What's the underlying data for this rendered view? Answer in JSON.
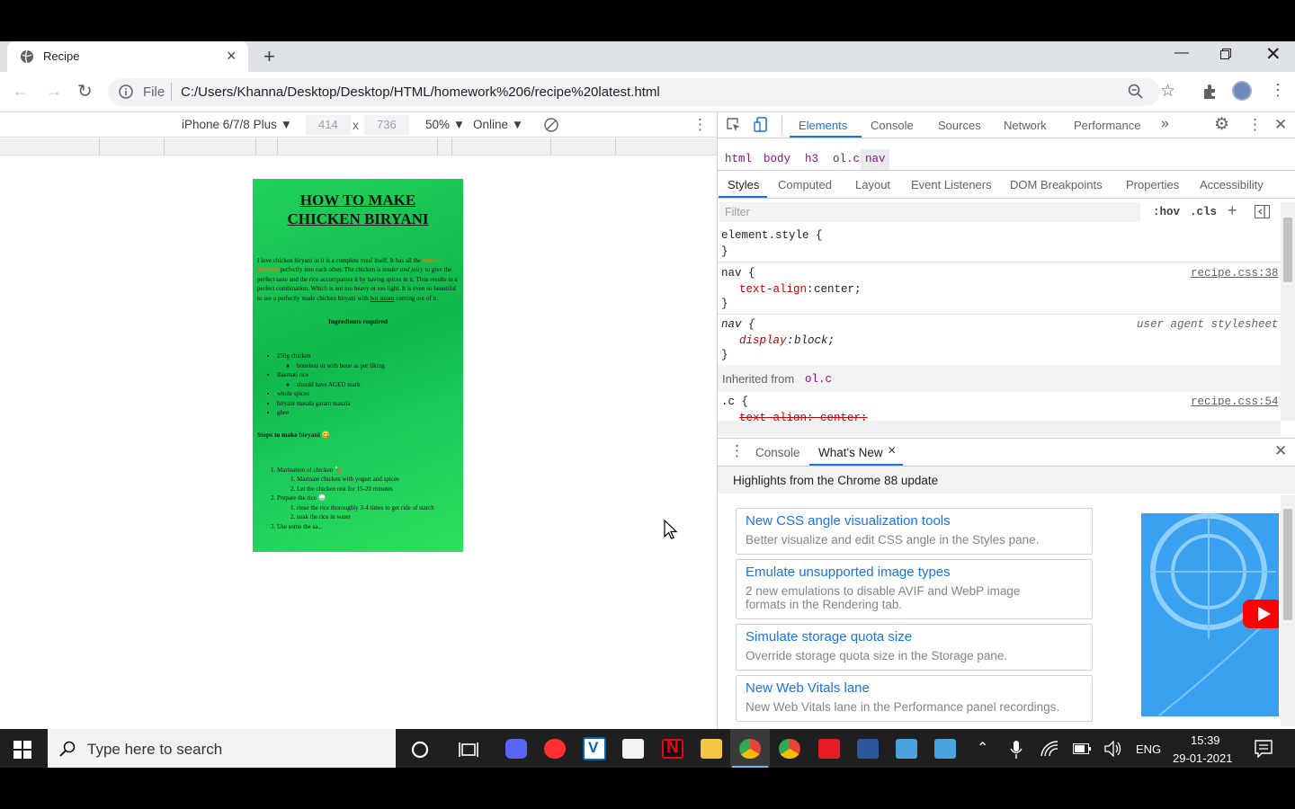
{
  "browser": {
    "tab_title": "Recipe",
    "address_prefix": "File",
    "url": "C:/Users/Khanna/Desktop/Desktop/HTML/homework%206/recipe%20latest.html"
  },
  "device_toolbar": {
    "device": "iPhone 6/7/8 Plus ▼",
    "width": "414",
    "x": "x",
    "height": "736",
    "zoom": "50% ▼",
    "network": "Online ▼"
  },
  "recipe_page": {
    "title_line1": "HOW TO MAKE",
    "title_line2": "CHICKEN BIRYANI",
    "intro_a": "I love chicken biryani as it is a complete meal itself. It has all the ",
    "intro_orange": "flavour blended",
    "intro_b": " perfectly into each other. The chicken is ",
    "intro_em": "tender and juicy",
    "intro_c": " to give the perfect taste and the rice accompanies it by having spices in it. Thus results in a perfect combination. Which is not too heavy or too light. It is even so beautiful to see a perfectly made chicken biryani with ",
    "intro_link": "hot steam",
    "intro_d": " coming out of it.",
    "ingredients_heading": "Ingredients required",
    "ing1": "250g chicken",
    "ing1_sub": "boneless or with bone as per liking",
    "ing2": "Basmati rice",
    "ing2_sub": "should have AGED mark",
    "ing3": "whole spices",
    "ing4": "biryani masala garam masala",
    "ing5": "ghee",
    "steps_heading": "Steps to make biryani 😋",
    "step1": "Marination of chicken 🍗",
    "step1_a": "Marinate chicken with yogurt and spices",
    "step1_b": "Let the chicken rest for 15-20 minutes",
    "step2": "Prepare the rice 🍚",
    "step2_a": "rinse the rice thoroughly 3-4 times to get ride of starch",
    "step2_b": "soak the rice in water",
    "step3": "Use some the sa..."
  },
  "devtools": {
    "tabs": [
      "Elements",
      "Console",
      "Sources",
      "Network",
      "Performance"
    ],
    "more": "»",
    "breadcrumb": [
      "html",
      "body",
      "h3",
      "ol.c",
      "nav"
    ],
    "subtabs": [
      "Styles",
      "Computed",
      "Layout",
      "Event Listeners",
      "DOM Breakpoints",
      "Properties",
      "Accessibility"
    ],
    "filter_placeholder": "Filter",
    "hov": ":hov",
    "cls": ".cls",
    "rule0_selector": "element.style {",
    "close_brace": "}",
    "rule1_selector": "nav {",
    "rule1_prop": "text-align",
    "rule1_val": " center;",
    "rule1_src": "recipe.css:38",
    "rule2_selector": "nav {",
    "rule2_prop": "display",
    "rule2_val": " block;",
    "rule2_src": "user agent stylesheet",
    "inherited_label": "Inherited from ",
    "inherited_from": "ol.c",
    "rule3_selector": ".c {",
    "rule3_src": "recipe.css:54",
    "rule3_prop": "text-align: center;",
    "drawer_tabs": [
      "Console",
      "What's New"
    ],
    "drawer_close_x": "×",
    "highlights": "Highlights from the Chrome 88 update",
    "cards": [
      {
        "title": "New CSS angle visualization tools",
        "desc": "Better visualize and edit CSS angle in the Styles pane."
      },
      {
        "title": "Emulate unsupported image types",
        "desc": "2 new emulations to disable AVIF and WebP image formats in the Rendering tab."
      },
      {
        "title": "Simulate storage quota size",
        "desc": "Override storage quota size in the Storage pane."
      },
      {
        "title": "New Web Vitals lane",
        "desc": "New Web Vitals lane in the Performance panel recordings."
      }
    ]
  },
  "taskbar": {
    "search_placeholder": "Type here to search",
    "language": "ENG",
    "time": "15:39",
    "date": "29-01-2021"
  },
  "colors": {
    "accent": "#1a73e8",
    "page_green": "#19c95a",
    "css_prop": "#c80000",
    "selector_purple": "#881280"
  }
}
